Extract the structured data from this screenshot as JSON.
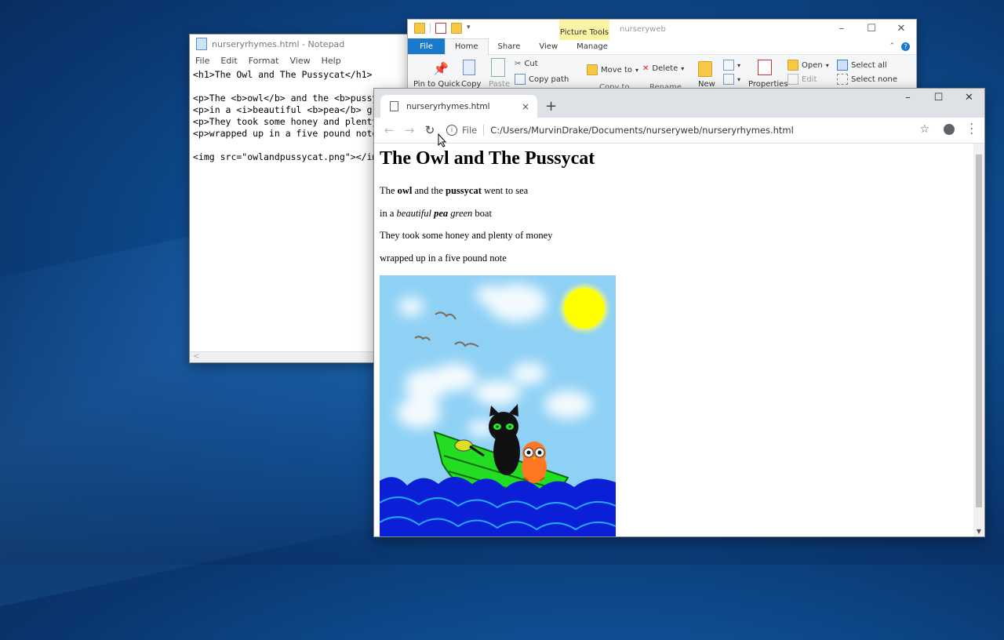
{
  "notepad": {
    "title": "nurseryrhymes.html - Notepad",
    "menu": [
      "File",
      "Edit",
      "Format",
      "View",
      "Help"
    ],
    "lines": [
      "<h1>The Owl and The Pussycat</h1>",
      "",
      "<p>The <b>owl</b> and the <b>pussyc",
      "<p>in a <i>beautiful <b>pea</b> gre",
      "<p>They took some honey and plenty",
      "<p>wrapped up in a five pound note<",
      "",
      "<img src=\"owlandpussycat.png\"></im"
    ],
    "scroll_left": "<"
  },
  "explorer": {
    "picture_tools": "Picture Tools",
    "folder_name": "nurseryweb",
    "tabs": [
      "File",
      "Home",
      "Share",
      "View",
      "Manage"
    ],
    "ribbon": {
      "pin": "Pin to Quick",
      "copy": "Copy",
      "paste": "Paste",
      "cut": "Cut",
      "copy_path": "Copy path",
      "move_to": "Move to",
      "copy_to": "Copy to",
      "delete": "Delete",
      "rename": "Rename",
      "new": "New",
      "properties": "Properties",
      "open": "Open",
      "edit": "Edit",
      "select_all": "Select all",
      "select_none": "Select none"
    }
  },
  "chrome": {
    "tab_title": "nurseryrhymes.html",
    "tab_close": "×",
    "new_tab": "+",
    "address_scheme": "File",
    "address_path": "C:/Users/MurvinDrake/Documents/nurseryweb/nurseryrhymes.html",
    "page": {
      "heading": "The Owl and The Pussycat",
      "p1": {
        "a": "The ",
        "b": "owl",
        "c": " and the ",
        "d": "pussycat",
        "e": " went to sea"
      },
      "p2": {
        "a": "in a ",
        "b": "beautiful ",
        "c": "pea",
        "d": " green",
        "e": " boat"
      },
      "p3": "They took some honey and plenty of money",
      "p4": "wrapped up in a five pound note"
    }
  },
  "colors": {
    "sky": "#8fd1f5",
    "sun": "#ffff00",
    "boat": "#22dd22",
    "sea": "#0a1fd6",
    "owl": "#ff7722",
    "cat": "#111111"
  },
  "icons": {
    "back": "arrow-left-icon",
    "forward": "arrow-right-icon",
    "reload": "reload-icon",
    "bookmark": "star-icon",
    "account": "account-icon",
    "menu": "more-vert-icon"
  }
}
